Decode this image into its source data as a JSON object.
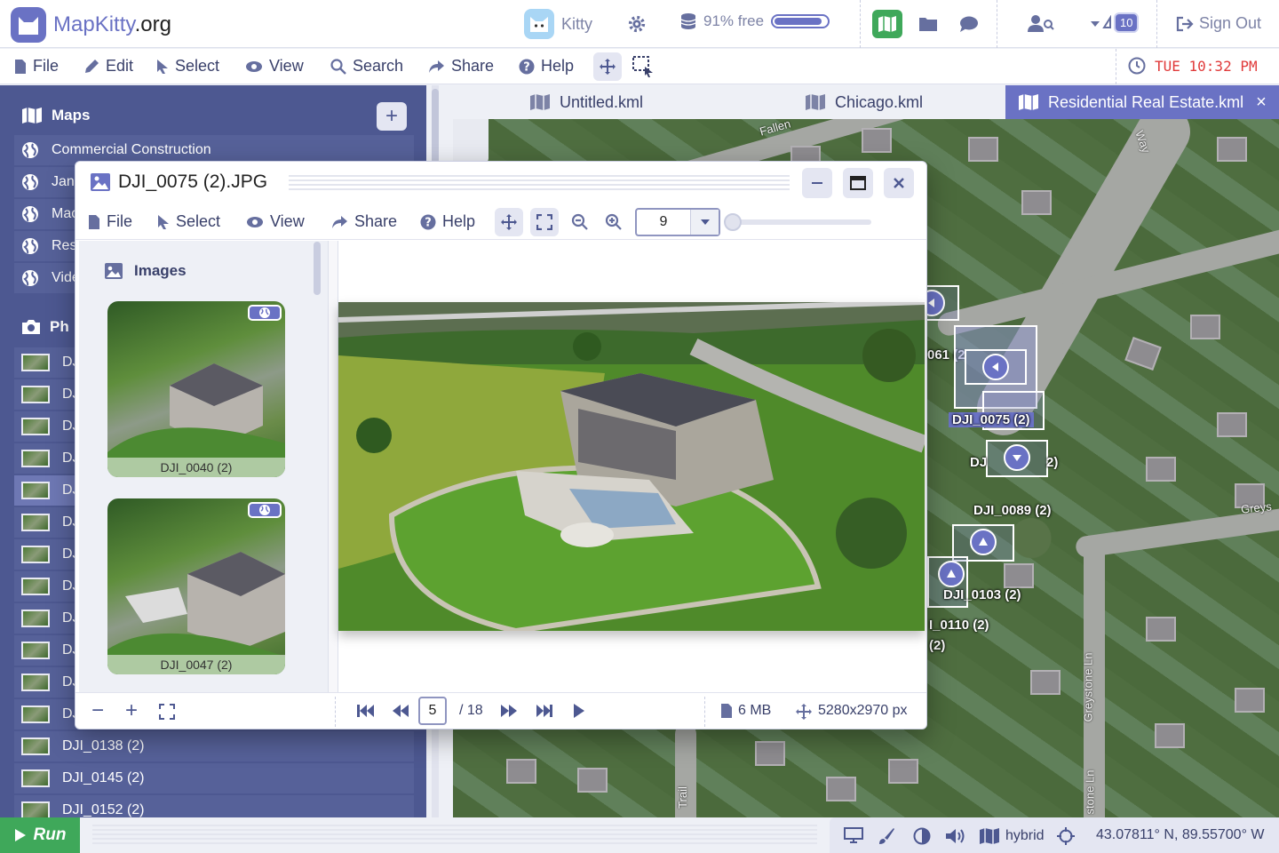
{
  "app": {
    "logo_text_blue": "MapKitty",
    "logo_text_dark": ".org",
    "user_name": "Kitty",
    "storage_label": "91% free",
    "storage_fraction": 0.91,
    "notification_count": "10",
    "sign_out_label": "Sign Out",
    "accent_color": "#6a72c4",
    "run_color": "#3fa85a"
  },
  "menu": {
    "file": "File",
    "edit": "Edit",
    "select": "Select",
    "view": "View",
    "search": "Search",
    "share": "Share",
    "help": "Help"
  },
  "clock": {
    "text": "TUE 10:32 PM"
  },
  "tabs": [
    {
      "label": "Untitled.kml"
    },
    {
      "label": "Chicago.kml"
    },
    {
      "label": "Residential Real Estate.kml",
      "close": "×"
    }
  ],
  "sidebar": {
    "maps_header": "Maps",
    "add_button": "+",
    "maps": [
      {
        "label": "Commercial Construction"
      },
      {
        "label": "Jan"
      },
      {
        "label": "Mac"
      },
      {
        "label": "Res"
      },
      {
        "label": "Vide"
      }
    ],
    "photos_header": "Ph",
    "photos": [
      {
        "label": "DJI_"
      },
      {
        "label": "DJI_"
      },
      {
        "label": "DJI_"
      },
      {
        "label": "DJI_"
      },
      {
        "label": "DJI_"
      },
      {
        "label": "DJI_"
      },
      {
        "label": "DJI_"
      },
      {
        "label": "DJI_"
      },
      {
        "label": "DJI_"
      },
      {
        "label": "DJI_"
      },
      {
        "label": "DJI_"
      },
      {
        "label": "DJI_"
      },
      {
        "label": "DJI_0138 (2)"
      },
      {
        "label": "DJI_0145 (2)"
      },
      {
        "label": "DJI_0152 (2)"
      }
    ]
  },
  "viewer": {
    "title": "DJI_0075 (2).JPG",
    "menu": {
      "file": "File",
      "select": "Select",
      "view": "View",
      "share": "Share",
      "help": "Help"
    },
    "zoom_value": "9",
    "images_header": "Images",
    "thumbnails": [
      {
        "label": "DJI_0040 (2)"
      },
      {
        "label": "DJI_0047 (2)"
      }
    ],
    "side_minus": "−",
    "side_plus": "+",
    "page_current": "5",
    "page_total": "/ 18",
    "file_size": "6 MB",
    "dimensions": "5280x2970 px"
  },
  "map": {
    "labels": [
      {
        "text": "061 (2"
      },
      {
        "text": "DJI_0075 (2)"
      },
      {
        "text": "DJ"
      },
      {
        "text": "2)"
      },
      {
        "text": "DJI_0089 (2)"
      },
      {
        "text": "DJI_0103 (2)"
      },
      {
        "text": "I_0110 (2)"
      },
      {
        "text": "(2)"
      }
    ],
    "streets": [
      {
        "text": "Fallen"
      },
      {
        "text": "Way"
      },
      {
        "text": "Greys"
      },
      {
        "text": "Greystone Ln"
      },
      {
        "text": "stone Ln"
      },
      {
        "text": "Trail"
      }
    ]
  },
  "status": {
    "run_label": "Run",
    "map_type": "hybrid",
    "coordinates": "43.07811° N,  89.55700° W"
  }
}
